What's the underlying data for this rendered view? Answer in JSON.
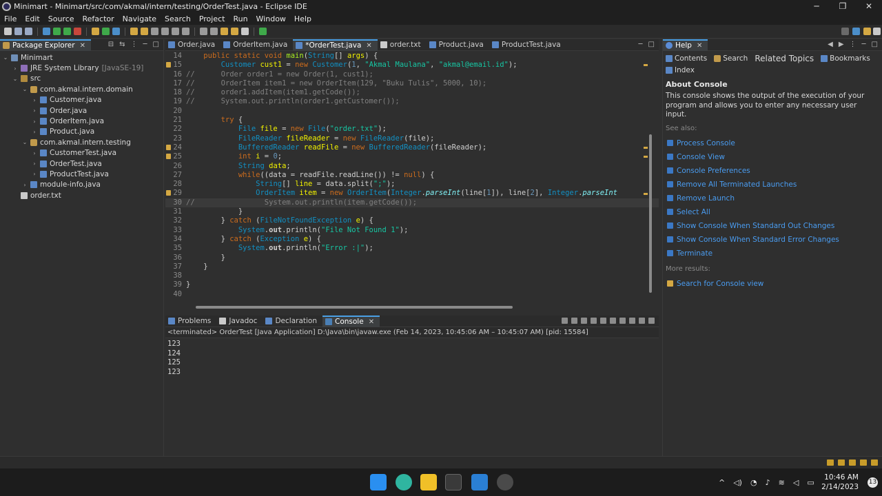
{
  "window": {
    "title": "Minimart - Minimart/src/com/akmal/intern/testing/OrderTest.java - Eclipse IDE",
    "controls": [
      "─",
      "❐",
      "✕"
    ]
  },
  "menu": [
    "File",
    "Edit",
    "Source",
    "Refactor",
    "Navigate",
    "Search",
    "Project",
    "Run",
    "Window",
    "Help"
  ],
  "package_explorer": {
    "title": "Package Explorer",
    "tree": [
      {
        "label": "Minimart",
        "depth": 0,
        "arrow": "⌄",
        "icon": "proj"
      },
      {
        "label": "JRE System Library",
        "suffix": "[JavaSE-19]",
        "depth": 1,
        "arrow": "›",
        "icon": "lib"
      },
      {
        "label": "src",
        "depth": 1,
        "arrow": "⌄",
        "icon": "src"
      },
      {
        "label": "com.akmal.intern.domain",
        "depth": 2,
        "arrow": "⌄",
        "icon": "pkg"
      },
      {
        "label": "Customer.java",
        "depth": 3,
        "arrow": "›",
        "icon": "java"
      },
      {
        "label": "Order.java",
        "depth": 3,
        "arrow": "›",
        "icon": "java"
      },
      {
        "label": "OrderItem.java",
        "depth": 3,
        "arrow": "›",
        "icon": "java"
      },
      {
        "label": "Product.java",
        "depth": 3,
        "arrow": "›",
        "icon": "java"
      },
      {
        "label": "com.akmal.intern.testing",
        "depth": 2,
        "arrow": "⌄",
        "icon": "pkg"
      },
      {
        "label": "CustomerTest.java",
        "depth": 3,
        "arrow": "›",
        "icon": "java"
      },
      {
        "label": "OrderTest.java",
        "depth": 3,
        "arrow": "›",
        "icon": "java"
      },
      {
        "label": "ProductTest.java",
        "depth": 3,
        "arrow": "›",
        "icon": "java"
      },
      {
        "label": "module-info.java",
        "depth": 2,
        "arrow": "›",
        "icon": "java"
      },
      {
        "label": "order.txt",
        "depth": 1,
        "arrow": "",
        "icon": "txt"
      }
    ]
  },
  "editor": {
    "tabs": [
      {
        "label": "Order.java",
        "icon": "java",
        "active": false
      },
      {
        "label": "OrderItem.java",
        "icon": "java",
        "active": false
      },
      {
        "label": "*OrderTest.java",
        "icon": "java",
        "active": true
      },
      {
        "label": "order.txt",
        "icon": "txt",
        "active": false
      },
      {
        "label": "Product.java",
        "icon": "java",
        "active": false
      },
      {
        "label": "ProductTest.java",
        "icon": "java",
        "active": false
      }
    ],
    "lines": [
      {
        "n": "14",
        "mark": false,
        "hl": false,
        "tokens": [
          [
            "",
            "    "
          ],
          [
            "kw",
            "public static void "
          ],
          [
            "fn",
            "main"
          ],
          [
            "",
            "("
          ],
          [
            "ty",
            "String"
          ],
          [
            "",
            "[] "
          ],
          [
            "vr",
            "args"
          ],
          [
            "",
            ") {"
          ]
        ]
      },
      {
        "n": "15",
        "mark": true,
        "hl": false,
        "tokens": [
          [
            "",
            "        "
          ],
          [
            "ty",
            "Customer "
          ],
          [
            "vr",
            "cust1"
          ],
          [
            "",
            " = "
          ],
          [
            "kw",
            "new "
          ],
          [
            "ty",
            "Customer"
          ],
          [
            "",
            "("
          ],
          [
            "num",
            "1"
          ],
          [
            "",
            ", "
          ],
          [
            "st",
            "\"Akmal Maulana\""
          ],
          [
            "",
            ", "
          ],
          [
            "st",
            "\"akmal@email.id\""
          ],
          [
            "",
            ");"
          ]
        ]
      },
      {
        "n": "16",
        "mark": false,
        "hl": false,
        "tokens": [
          [
            "cm",
            "//      Order order1 = new Order(1, cust1);"
          ]
        ]
      },
      {
        "n": "17",
        "mark": false,
        "hl": false,
        "tokens": [
          [
            "cm",
            "//      OrderItem item1 = new OrderItem(129, \"Buku Tulis\", 5000, 10);"
          ]
        ]
      },
      {
        "n": "18",
        "mark": false,
        "hl": false,
        "tokens": [
          [
            "cm",
            "//      order1.addItem(item1.getCode());"
          ]
        ]
      },
      {
        "n": "19",
        "mark": false,
        "hl": false,
        "tokens": [
          [
            "cm",
            "//      System.out.println(order1.getCustomer());"
          ]
        ]
      },
      {
        "n": "20",
        "mark": false,
        "hl": false,
        "tokens": [
          [
            "",
            ""
          ]
        ]
      },
      {
        "n": "21",
        "mark": false,
        "hl": false,
        "tokens": [
          [
            "",
            "        "
          ],
          [
            "kw",
            "try"
          ],
          [
            "",
            " {"
          ]
        ]
      },
      {
        "n": "22",
        "mark": false,
        "hl": false,
        "tokens": [
          [
            "",
            "            "
          ],
          [
            "ty",
            "File "
          ],
          [
            "vr",
            "file"
          ],
          [
            "",
            " = "
          ],
          [
            "kw",
            "new "
          ],
          [
            "ty",
            "File"
          ],
          [
            "",
            "("
          ],
          [
            "st",
            "\"order.txt\""
          ],
          [
            "",
            ");"
          ]
        ]
      },
      {
        "n": "23",
        "mark": false,
        "hl": false,
        "tokens": [
          [
            "",
            "            "
          ],
          [
            "ty",
            "FileReader "
          ],
          [
            "vr",
            "fileReader"
          ],
          [
            "",
            " = "
          ],
          [
            "kw",
            "new "
          ],
          [
            "ty",
            "FileReader"
          ],
          [
            "",
            "(file);"
          ]
        ]
      },
      {
        "n": "24",
        "mark": true,
        "hl": false,
        "tokens": [
          [
            "",
            "            "
          ],
          [
            "ty",
            "BufferedReader "
          ],
          [
            "vr",
            "readFile"
          ],
          [
            "",
            " = "
          ],
          [
            "kw",
            "new "
          ],
          [
            "ty",
            "BufferedReader"
          ],
          [
            "",
            "(fileReader);"
          ]
        ]
      },
      {
        "n": "25",
        "mark": true,
        "hl": false,
        "tokens": [
          [
            "",
            "            "
          ],
          [
            "kw",
            "int "
          ],
          [
            "vr",
            "i"
          ],
          [
            "",
            " = "
          ],
          [
            "num",
            "0"
          ],
          [
            "",
            ";"
          ]
        ]
      },
      {
        "n": "26",
        "mark": false,
        "hl": false,
        "tokens": [
          [
            "",
            "            "
          ],
          [
            "ty",
            "String "
          ],
          [
            "vr",
            "data"
          ],
          [
            "",
            ";"
          ]
        ]
      },
      {
        "n": "27",
        "mark": false,
        "hl": false,
        "tokens": [
          [
            "",
            "            "
          ],
          [
            "kw",
            "while"
          ],
          [
            "",
            "((data = readFile.readLine()) != "
          ],
          [
            "kw",
            "null"
          ],
          [
            "",
            ") {"
          ]
        ]
      },
      {
        "n": "28",
        "mark": false,
        "hl": false,
        "tokens": [
          [
            "",
            "                "
          ],
          [
            "ty",
            "String"
          ],
          [
            "",
            "[] "
          ],
          [
            "vr",
            "line"
          ],
          [
            "",
            " = data.split("
          ],
          [
            "st",
            "\";\""
          ],
          [
            "",
            ");"
          ]
        ]
      },
      {
        "n": "29",
        "mark": true,
        "hl": false,
        "tokens": [
          [
            "",
            "                "
          ],
          [
            "ty",
            "OrderItem "
          ],
          [
            "vr",
            "item"
          ],
          [
            "",
            " = "
          ],
          [
            "kw",
            "new "
          ],
          [
            "ty",
            "OrderItem"
          ],
          [
            "",
            "("
          ],
          [
            "ty",
            "Integer"
          ],
          [
            "",
            "."
          ],
          [
            "it",
            "parseInt"
          ],
          [
            "",
            "(line["
          ],
          [
            "num",
            "1"
          ],
          [
            "",
            "]), line["
          ],
          [
            "num",
            "2"
          ],
          [
            "",
            "], "
          ],
          [
            "ty",
            "Integer"
          ],
          [
            "",
            "."
          ],
          [
            "it",
            "parseInt"
          ]
        ]
      },
      {
        "n": "30",
        "mark": false,
        "hl": true,
        "tokens": [
          [
            "cm",
            "//                System.out.println(item.getCode());"
          ]
        ]
      },
      {
        "n": "31",
        "mark": false,
        "hl": false,
        "tokens": [
          [
            "",
            "            }"
          ]
        ]
      },
      {
        "n": "32",
        "mark": false,
        "hl": false,
        "tokens": [
          [
            "",
            "        } "
          ],
          [
            "kw",
            "catch "
          ],
          [
            "",
            "("
          ],
          [
            "ty",
            "FileNotFoundException "
          ],
          [
            "vr",
            "e"
          ],
          [
            "",
            ") {"
          ]
        ]
      },
      {
        "n": "33",
        "mark": false,
        "hl": false,
        "tokens": [
          [
            "",
            "            "
          ],
          [
            "ty",
            "System"
          ],
          [
            "",
            "."
          ],
          [
            "sf",
            "out"
          ],
          [
            "",
            ".println("
          ],
          [
            "st",
            "\"File Not Found 1\""
          ],
          [
            "",
            ");"
          ]
        ]
      },
      {
        "n": "34",
        "mark": false,
        "hl": false,
        "tokens": [
          [
            "",
            "        } "
          ],
          [
            "kw",
            "catch "
          ],
          [
            "",
            "("
          ],
          [
            "ty",
            "Exception "
          ],
          [
            "vr",
            "e"
          ],
          [
            "",
            ") {"
          ]
        ]
      },
      {
        "n": "35",
        "mark": false,
        "hl": false,
        "tokens": [
          [
            "",
            "            "
          ],
          [
            "ty",
            "System"
          ],
          [
            "",
            "."
          ],
          [
            "sf",
            "out"
          ],
          [
            "",
            ".println("
          ],
          [
            "st",
            "\"Error :|\""
          ],
          [
            "",
            ");"
          ]
        ]
      },
      {
        "n": "36",
        "mark": false,
        "hl": false,
        "tokens": [
          [
            "",
            "        }"
          ]
        ]
      },
      {
        "n": "37",
        "mark": false,
        "hl": false,
        "tokens": [
          [
            "",
            "    }"
          ]
        ]
      },
      {
        "n": "38",
        "mark": false,
        "hl": false,
        "tokens": [
          [
            "",
            ""
          ]
        ]
      },
      {
        "n": "39",
        "mark": false,
        "hl": false,
        "tokens": [
          [
            "",
            "}"
          ]
        ]
      },
      {
        "n": "40",
        "mark": false,
        "hl": false,
        "tokens": [
          [
            "",
            ""
          ]
        ]
      }
    ]
  },
  "console": {
    "tabs": [
      {
        "label": "Problems",
        "icon": "java",
        "active": false
      },
      {
        "label": "Javadoc",
        "icon": "txt",
        "active": false
      },
      {
        "label": "Declaration",
        "icon": "java",
        "active": false
      },
      {
        "label": "Console",
        "icon": "console",
        "active": true
      }
    ],
    "status": "<terminated> OrderTest [Java Application] D:\\Java\\bin\\javaw.exe  (Feb 14, 2023, 10:45:06 AM – 10:45:07 AM) [pid: 15584]",
    "output": [
      "123",
      "124",
      "125",
      "123"
    ]
  },
  "help": {
    "title": "Help",
    "nav": {
      "contents": "Contents",
      "search": "Search",
      "related": "Related Topics",
      "bookmarks": "Bookmarks",
      "index": "Index"
    },
    "heading": "About Console",
    "description": "This console shows the output of the execution of your program and allows you to enter any necessary user input.",
    "see_also": "See also:",
    "links": [
      "Process Console",
      "Console View",
      "Console Preferences",
      "Remove All Terminated Launches",
      "Remove Launch",
      "Select All",
      "Show Console When Standard Out Changes",
      "Show Console When Standard Error Changes",
      "Terminate"
    ],
    "more_results": "More results:",
    "search_link": "Search for Console view"
  },
  "taskbar": {
    "time": "10:46 AM",
    "date": "2/14/2023",
    "notifications": "13"
  },
  "colors": {
    "accent": "#4aa0e6",
    "link": "#4a9cf0",
    "keyword": "#cc6c1d",
    "type": "#1290c3",
    "string": "#17c6a3",
    "comment": "#808080",
    "variable": "#f2f200"
  }
}
